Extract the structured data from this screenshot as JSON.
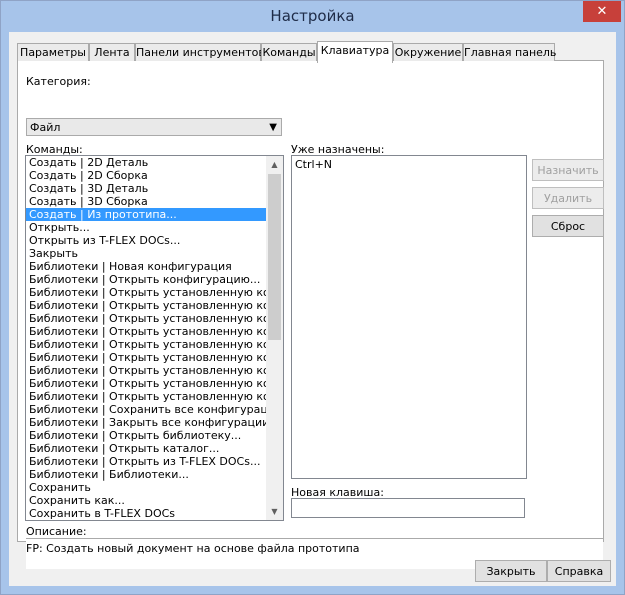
{
  "window": {
    "title": "Настройка",
    "close_glyph": "✕"
  },
  "tabs": [
    {
      "label": "Параметры"
    },
    {
      "label": "Лента"
    },
    {
      "label": "Панели инструментов"
    },
    {
      "label": "Команды"
    },
    {
      "label": "Клавиатура",
      "active": true
    },
    {
      "label": "Окружение"
    },
    {
      "label": "Главная панель"
    }
  ],
  "category": {
    "label": "Категория:",
    "value": "Файл"
  },
  "commands": {
    "label": "Команды:",
    "selected_index": 4,
    "items": [
      "Создать | 2D Деталь",
      "Создать | 2D Сборка",
      "Создать | 3D Деталь",
      "Создать | 3D Сборка",
      "Создать | Из прототипа...",
      "Открыть...",
      "Открыть из T-FLEX DOCs...",
      "Закрыть",
      "Библиотеки | Новая конфигурация",
      "Библиотеки | Открыть конфигурацию...",
      "Библиотеки | Открыть установленную конфи",
      "Библиотеки | Открыть установленную конфи",
      "Библиотеки | Открыть установленную конфи",
      "Библиотеки | Открыть установленную конфи",
      "Библиотеки | Открыть установленную конфи",
      "Библиотеки | Открыть установленную конфи",
      "Библиотеки | Открыть установленную конфи",
      "Библиотеки | Открыть установленную конфи",
      "Библиотеки | Открыть установленную конфи",
      "Библиотеки | Сохранить все конфигурации",
      "Библиотеки | Закрыть все конфигурации",
      "Библиотеки | Открыть библиотеку...",
      "Библиотеки | Открыть каталог...",
      "Библиотеки | Открыть из T-FLEX DOCs...",
      "Библиотеки | Библиотеки...",
      "Сохранить",
      "Сохранить как...",
      "Сохранить в T-FLEX DOCs"
    ]
  },
  "assigned": {
    "label": "Уже назначены:",
    "items": [
      "Ctrl+N"
    ]
  },
  "buttons": {
    "assign": "Назначить",
    "remove": "Удалить",
    "reset": "Сброс",
    "close": "Закрыть",
    "help": "Справка"
  },
  "new_key": {
    "label": "Новая клавиша:",
    "value": ""
  },
  "description": {
    "label": "Описание:",
    "text": "FP: Создать новый документ на основе файла прототипа"
  }
}
